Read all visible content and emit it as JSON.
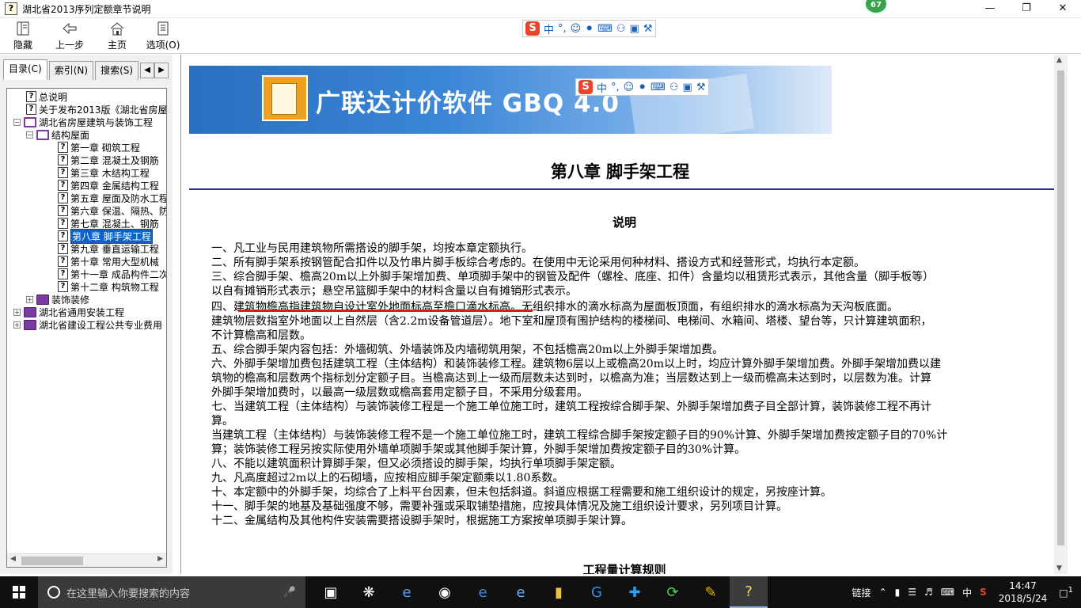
{
  "window": {
    "title": "湖北省2013序列定额章节说明",
    "badge": "67"
  },
  "toolbar": {
    "buttons": [
      {
        "label": "隐藏",
        "icon": "hide-icon"
      },
      {
        "label": "上一步",
        "icon": "back-arrow-icon"
      },
      {
        "label": "主页",
        "icon": "home-icon"
      },
      {
        "label": "选项(O)",
        "icon": "options-icon"
      }
    ]
  },
  "ime": {
    "logo": "S",
    "mode": "中",
    "punct": "°,"
  },
  "nav": {
    "tabs": [
      "目录(C)",
      "索引(N)",
      "搜索(S)"
    ],
    "tree": [
      {
        "label": "总说明",
        "level": 1,
        "type": "page"
      },
      {
        "label": "关于发布2013版《湖北省房屋",
        "level": 1,
        "type": "page"
      },
      {
        "label": "湖北省房屋建筑与装饰工程",
        "level": 0,
        "type": "book-open",
        "expanded": true
      },
      {
        "label": "结构屋面",
        "level": 1,
        "type": "book-open",
        "expanded": true
      },
      {
        "label": "第一章 砌筑工程",
        "level": 2,
        "type": "page"
      },
      {
        "label": "第二章 混凝土及钢筋",
        "level": 2,
        "type": "page"
      },
      {
        "label": "第三章 木结构工程",
        "level": 2,
        "type": "page"
      },
      {
        "label": "第四章 金属结构工程",
        "level": 2,
        "type": "page"
      },
      {
        "label": "第五章 屋面及防水工程",
        "level": 2,
        "type": "page"
      },
      {
        "label": "第六章 保温、隔热、防",
        "level": 2,
        "type": "page"
      },
      {
        "label": "第七章 混凝土、钢筋",
        "level": 2,
        "type": "page"
      },
      {
        "label": "第八章 脚手架工程",
        "level": 2,
        "type": "page",
        "selected": true
      },
      {
        "label": "第九章 垂直运输工程",
        "level": 2,
        "type": "page"
      },
      {
        "label": "第十章 常用大型机械",
        "level": 2,
        "type": "page"
      },
      {
        "label": "第十一章 成品构件二次",
        "level": 2,
        "type": "page"
      },
      {
        "label": "第十二章 构筑物工程",
        "level": 2,
        "type": "page"
      },
      {
        "label": "装饰装修",
        "level": 1,
        "type": "book",
        "expanded": false
      },
      {
        "label": "湖北省通用安装工程",
        "level": 0,
        "type": "book",
        "expanded": false
      },
      {
        "label": "湖北省建设工程公共专业费用",
        "level": 0,
        "type": "book",
        "expanded": false
      }
    ]
  },
  "content": {
    "banner_title": "广联达计价软件 GBQ 4.0",
    "chapter_title": "第八章 脚手架工程",
    "section_title": "说明",
    "paragraphs": [
      "一、凡工业与民用建筑物所需搭设的脚手架，均按本章定额执行。",
      "二、所有脚手架系按钢管配合扣件以及竹串片脚手板综合考虑的。在使用中无论采用何种材料、搭设方式和经营形式，均执行本定额。",
      "三、综合脚手架、檐高20m以上外脚手架增加费、单项脚手架中的钢管及配件（螺栓、底座、扣件）含量均以租赁形式表示，其他含量（脚手板等）",
      "以自有摊销形式表示；悬空吊篮脚手架中的材料含量以自有摊销形式表示。",
      "四、建筑物檐高指建筑物自设计室外地面标高至檐口滴水标高。无组织排水的滴水标高为屋面板顶面，有组织排水的滴水标高为天沟板底面。",
      "建筑物层数指室外地面以上自然层（含2.2m设备管道层）。地下室和屋顶有围护结构的楼梯间、电梯间、水箱间、塔楼、望台等，只计算建筑面积，",
      "不计算檐高和层数。",
      "五、综合脚手架内容包括：外墙砌筑、外墙装饰及内墙砌筑用架，不包括檐高20m以上外脚手架增加费。",
      "六、外脚手架增加费包括建筑工程（主体结构）和装饰装修工程。建筑物6层以上或檐高20m以上时，均应计算外脚手架增加费。外脚手架增加费以建",
      "筑物的檐高和层数两个指标划分定额子目。当檐高达到上一级而层数未达到时，以檐高为准；当层数达到上一级而檐高未达到时，以层数为准。计算",
      "外脚手架增加费时，以最高一级层数或檐高套用定额子目，不采用分级套用。",
      "七、当建筑工程（主体结构）与装饰装修工程是一个施工单位施工时，建筑工程按综合脚手架、外脚手架增加费子目全部计算，装饰装修工程不再计",
      "算。",
      "当建筑工程（主体结构）与装饰装修工程不是一个施工单位施工时，建筑工程综合脚手架按定额子目的90%计算、外脚手架增加费按定额子目的70%计",
      "算；装饰装修工程另按实际使用外墙单项脚手架或其他脚手架计算，外脚手架增加费按定额子目的30%计算。",
      "八、不能以建筑面积计算脚手架，但又必须搭设的脚手架，均执行单项脚手架定额。",
      "九、凡高度超过2m以上的石砌墙，应按相应脚手架定额乘以1.80系数。",
      "十、本定额中的外脚手架，均综合了上料平台因素，但未包括斜道。斜道应根据工程需要和施工组织设计的规定，另按座计算。",
      "十一、脚手架的地基及基础强度不够，需要补强或采取铺垫措施，应按具体情况及施工组织设计要求，另列项目计算。",
      "十二、金属结构及其他构件安装需要搭设脚手架时，根据施工方案按单项脚手架计算。"
    ],
    "next_section_title": "工程量计算规则"
  },
  "taskbar": {
    "search_placeholder": "在这里输入你要搜索的内容",
    "tray_link": "链接",
    "tray_lang": "中",
    "time": "14:47",
    "date": "2018/5/24",
    "notifications": "1"
  }
}
